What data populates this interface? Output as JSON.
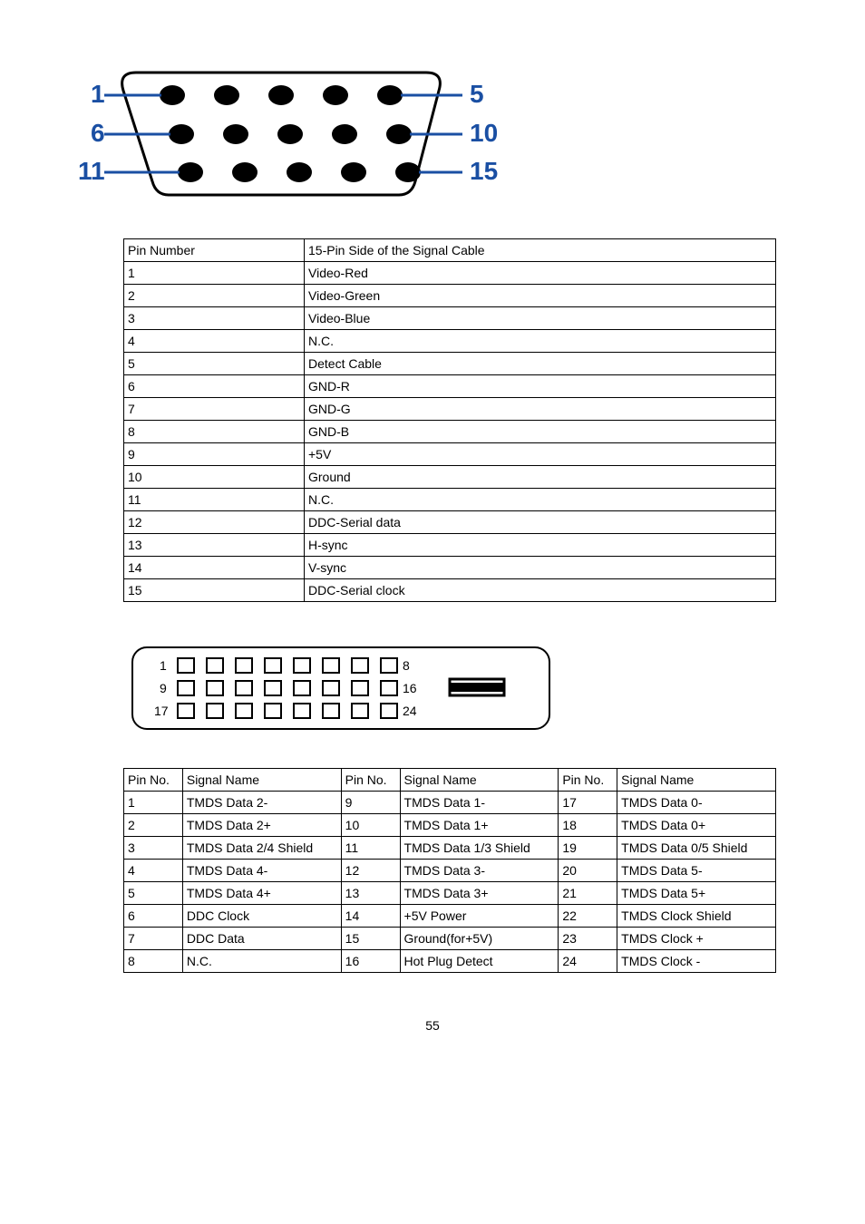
{
  "vga": {
    "labels": {
      "l1": "1",
      "l5": "5",
      "l6": "6",
      "l10": "10",
      "l11": "11",
      "l15": "15"
    },
    "header": {
      "pin": "Pin Number",
      "desc": "15-Pin Side of the Signal Cable"
    },
    "rows": [
      {
        "pin": "1",
        "desc": "Video-Red"
      },
      {
        "pin": "2",
        "desc": "Video-Green"
      },
      {
        "pin": "3",
        "desc": "Video-Blue"
      },
      {
        "pin": "4",
        "desc": "N.C."
      },
      {
        "pin": "5",
        "desc": "Detect Cable"
      },
      {
        "pin": "6",
        "desc": "GND-R"
      },
      {
        "pin": "7",
        "desc": "GND-G"
      },
      {
        "pin": "8",
        "desc": "GND-B"
      },
      {
        "pin": "9",
        "desc": "+5V"
      },
      {
        "pin": "10",
        "desc": "Ground"
      },
      {
        "pin": "11",
        "desc": "N.C."
      },
      {
        "pin": "12",
        "desc": "DDC-Serial data"
      },
      {
        "pin": "13",
        "desc": "H-sync"
      },
      {
        "pin": "14",
        "desc": "V-sync"
      },
      {
        "pin": "15",
        "desc": "DDC-Serial clock"
      }
    ]
  },
  "dvi": {
    "labels": {
      "l1": "1",
      "l8": "8",
      "l9": "9",
      "l16": "16",
      "l17": "17",
      "l24": "24"
    },
    "header": {
      "pin": "Pin No.",
      "sig": "Signal Name"
    },
    "rows": [
      {
        "p1": "1",
        "s1": "TMDS Data 2-",
        "p2": "9",
        "s2": "TMDS Data 1-",
        "p3": "17",
        "s3": "TMDS Data 0-"
      },
      {
        "p1": "2",
        "s1": "TMDS Data 2+",
        "p2": "10",
        "s2": "TMDS Data 1+",
        "p3": "18",
        "s3": "TMDS Data 0+"
      },
      {
        "p1": "3",
        "s1": "TMDS Data 2/4 Shield",
        "p2": "11",
        "s2": "TMDS Data 1/3 Shield",
        "p3": "19",
        "s3": "TMDS Data 0/5 Shield"
      },
      {
        "p1": "4",
        "s1": "TMDS Data 4-",
        "p2": "12",
        "s2": "TMDS Data 3-",
        "p3": "20",
        "s3": "TMDS Data 5-"
      },
      {
        "p1": "5",
        "s1": "TMDS Data 4+",
        "p2": "13",
        "s2": "TMDS Data 3+",
        "p3": "21",
        "s3": "TMDS Data 5+"
      },
      {
        "p1": "6",
        "s1": "DDC Clock",
        "p2": "14",
        "s2": "+5V Power",
        "p3": "22",
        "s3": "TMDS Clock Shield"
      },
      {
        "p1": "7",
        "s1": "DDC Data",
        "p2": "15",
        "s2": "Ground(for+5V)",
        "p3": "23",
        "s3": "TMDS Clock +"
      },
      {
        "p1": "8",
        "s1": "N.C.",
        "p2": "16",
        "s2": "Hot Plug Detect",
        "p3": "24",
        "s3": "TMDS Clock -"
      }
    ]
  },
  "page_number": "55"
}
